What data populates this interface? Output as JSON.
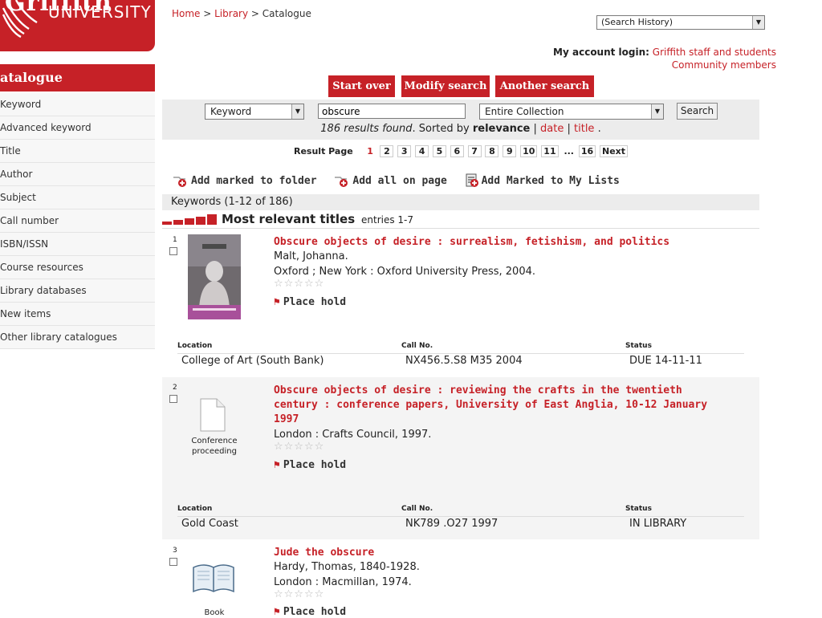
{
  "logo": {
    "mark": "Griffith",
    "name": "UNIVERSITY"
  },
  "sidebar": {
    "title": "atalogue",
    "items": [
      "Keyword",
      "Advanced keyword",
      "Title",
      "Author",
      "Subject",
      "Call number",
      "ISBN/ISSN",
      "Course resources",
      "Library databases",
      "New items",
      "Other library catalogues"
    ]
  },
  "breadcrumb": {
    "home": "Home",
    "sep1": " > ",
    "library": "Library",
    "sep2": " > ",
    "current": "Catalogue"
  },
  "history_select": "(Search History)",
  "account": {
    "label": "My account login:",
    "link1": "Griffith staff and students",
    "link2": "Community members"
  },
  "buttons": {
    "start_over": "Start over",
    "modify": "Modify search",
    "another": "Another search"
  },
  "search": {
    "type": "Keyword",
    "query": "obscure",
    "scope": "Entire Collection",
    "button": "Search"
  },
  "results_info": {
    "found": "186 results found",
    "sorted": ". Sorted by ",
    "relevance": "relevance",
    "sep": " | ",
    "date": "date",
    "title": "title",
    "end": " ."
  },
  "pager": {
    "label": "Result Page",
    "pages": [
      "1",
      "2",
      "3",
      "4",
      "5",
      "6",
      "7",
      "8",
      "9",
      "10",
      "11"
    ],
    "ellipsis": "...",
    "last": "16",
    "next": "Next"
  },
  "toolbar": {
    "add_marked": "Add marked to folder",
    "add_all": "Add all on page",
    "add_lists": "Add Marked to My Lists"
  },
  "keywords_label": "Keywords (1-12 of 186)",
  "relevant": {
    "title": "Most relevant titles",
    "entries": "entries 1-7"
  },
  "holdings_headers": {
    "location": "Location",
    "call_no": "Call No.",
    "status": "Status"
  },
  "results": [
    {
      "num": "1",
      "title": "Obscure objects of desire : surrealism, fetishism, and politics",
      "author": "Malt, Johanna.",
      "pub": "Oxford ; New York : Oxford University Press, 2004.",
      "stars": "☆☆☆☆☆",
      "hold": "Place hold",
      "location": "College of Art (South Bank)",
      "call_no": "NX456.5.S8 M35 2004",
      "status": "DUE 14-11-11"
    },
    {
      "num": "2",
      "title": "Obscure objects of desire : reviewing the crafts in the twentieth century : conference papers, University of East Anglia, 10-12 January 1997",
      "pub": "London : Crafts Council, 1997.",
      "format": "Conference proceeding",
      "stars": "☆☆☆☆☆",
      "hold": "Place hold",
      "location": "Gold Coast",
      "call_no": "NK789 .O27 1997",
      "status": "IN LIBRARY"
    },
    {
      "num": "3",
      "title": "Jude the obscure",
      "author": "Hardy, Thomas, 1840-1928.",
      "pub": "London : Macmillan, 1974.",
      "format": "Book",
      "stars": "☆☆☆☆☆",
      "hold": "Place hold"
    }
  ]
}
